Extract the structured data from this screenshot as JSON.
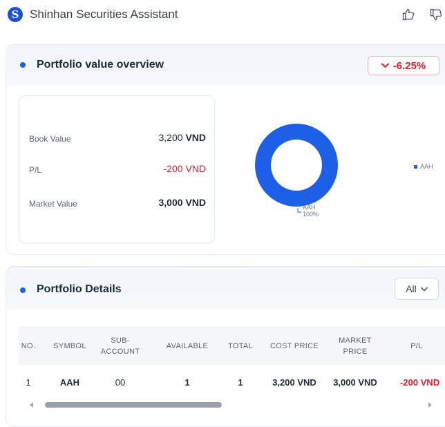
{
  "header": {
    "logo_letter": "S",
    "title": "Shinhan Securities Assistant"
  },
  "overview": {
    "title": "Portfolio value overview",
    "change": "-6.25%",
    "rows": [
      {
        "label": "Book Value",
        "number": "3,200",
        "currency": "VND"
      },
      {
        "label": "P/L",
        "number": "-200",
        "currency": "VND"
      },
      {
        "label": "Market Value",
        "number": "3,000",
        "currency": "VND"
      }
    ],
    "chart": {
      "slice_label": "AAH",
      "slice_percent": "100%",
      "legend": "AAH"
    }
  },
  "chart_data": {
    "type": "pie",
    "categories": [
      "AAH"
    ],
    "values": [
      100
    ],
    "legend_position": "right",
    "colors": [
      "#1d5fe6"
    ]
  },
  "details": {
    "title": "Portfolio Details",
    "filter_value": "All",
    "columns": [
      "NO.",
      "SYMBOL",
      "SUB-\nACCOUNT",
      "AVAILABLE",
      "TOTAL",
      "COST PRICE",
      "MARKET\nPRICE",
      "P/L"
    ],
    "rows": [
      {
        "no": "1",
        "symbol": "AAH",
        "sub_account": "00",
        "available": "1",
        "total": "1",
        "cost_price": "3,200 VND",
        "market_price": "3,000 VND",
        "pl": "-200 VND"
      }
    ]
  },
  "colors": {
    "accent": "#1d5fe6",
    "negative": "#e11d2e",
    "brand": "#1c4fd9"
  }
}
